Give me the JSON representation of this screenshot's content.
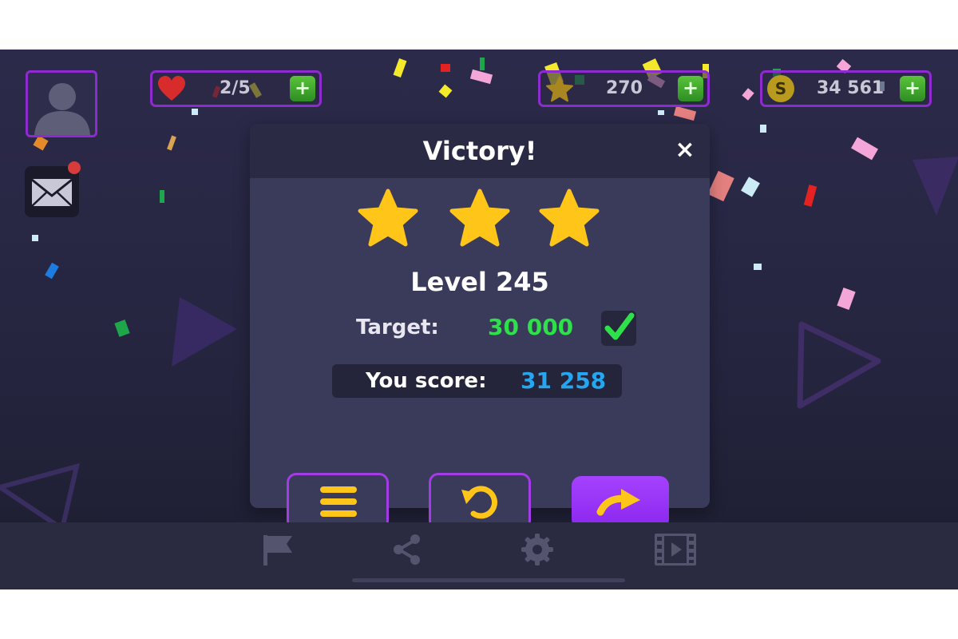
{
  "top_bar": {
    "lives": {
      "value": "2/5",
      "plus": "+"
    },
    "stars": {
      "value": "270",
      "plus": "+"
    },
    "coins": {
      "value": "34 561",
      "coin_letter": "S",
      "plus": "+"
    }
  },
  "dialog": {
    "title": "Victory!",
    "close": "×",
    "stars_earned": 3,
    "stars_total": 3,
    "level": "Level 245",
    "target_label": "Target:",
    "target_value": "30 000",
    "score_label": "You score:",
    "score_value": "31 258",
    "buttons": [
      "menu-icon",
      "restart-icon",
      "next-arrow-icon"
    ]
  },
  "icons": {
    "profile": "avatar",
    "mail": "envelope-icon",
    "bottom_nav": [
      "flag-icon",
      "share-icon",
      "gear-icon",
      "video-icon"
    ]
  },
  "colors": {
    "accent_purple": "#8d2bd0",
    "star_yellow": "#ffc619",
    "target_green": "#2ee04a",
    "score_blue": "#27a6f0",
    "plus_green": "#46b12e"
  }
}
